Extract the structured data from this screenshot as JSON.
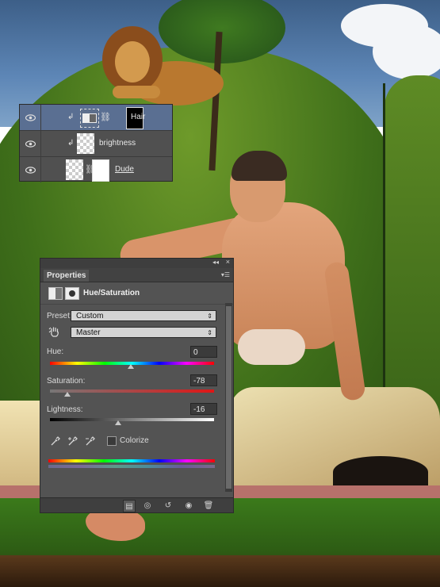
{
  "layers_panel": {
    "rows": [
      {
        "name": "Hair",
        "selected": true
      },
      {
        "name": "brightness",
        "selected": false
      },
      {
        "name": "Dude",
        "selected": false
      }
    ]
  },
  "properties_panel": {
    "tab_label": "Properties",
    "adjustment_title": "Hue/Saturation",
    "preset_label": "Preset:",
    "preset_value": "Custom",
    "channel_value": "Master",
    "hue_label": "Hue:",
    "hue_value": "0",
    "saturation_label": "Saturation:",
    "saturation_value": "-78",
    "lightness_label": "Lightness:",
    "lightness_value": "-16",
    "colorize_label": "Colorize",
    "colorize_checked": false
  },
  "icons": [
    "eye-icon",
    "adjustment-icon",
    "mask-icon",
    "hand-tool-icon",
    "eyedropper-icon",
    "eyedropper-plus-icon",
    "eyedropper-minus-icon",
    "clip-to-layer-icon",
    "view-previous-icon",
    "reset-icon",
    "visibility-icon",
    "trash-icon"
  ]
}
